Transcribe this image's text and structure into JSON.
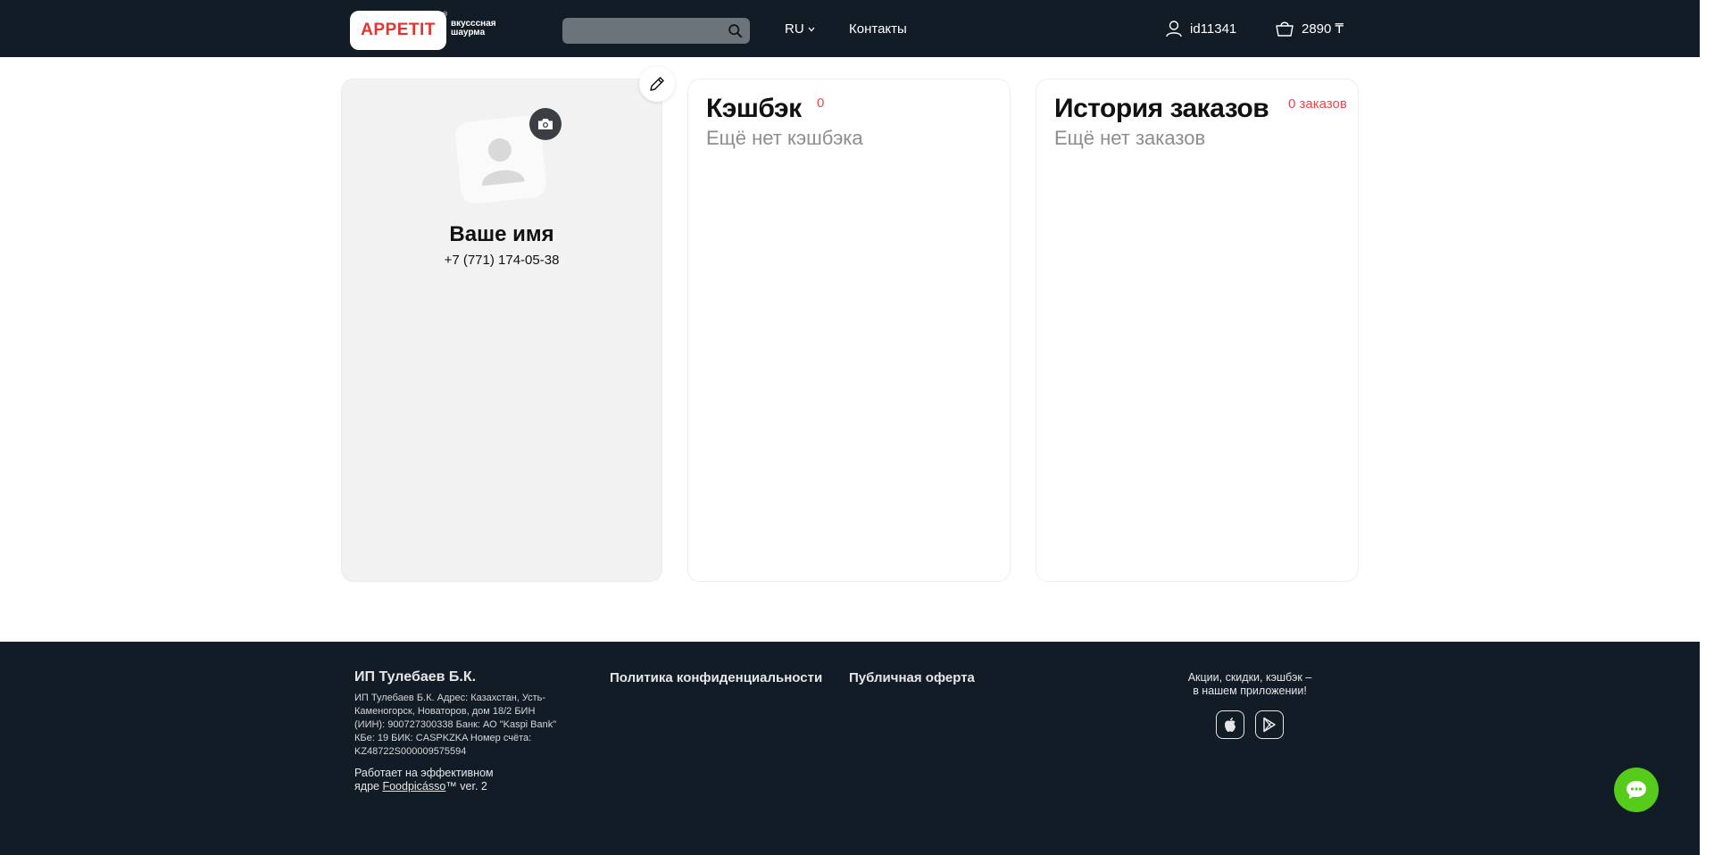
{
  "header": {
    "logo_text": "APPETIT",
    "logo_mark": "®",
    "tagline_line1": "вкусссная",
    "tagline_line2": "шаурма",
    "search": {
      "placeholder": "",
      "value": "",
      "icon": "search-icon"
    },
    "language": "RU",
    "contacts_label": "Контакты",
    "user_id": "id11341",
    "cart_total": "2890 ₸"
  },
  "profile": {
    "name": "Ваше имя",
    "phone": "+7 (771) 174-05-38"
  },
  "cashback": {
    "title": "Кэшбэк",
    "count": "0",
    "empty_text": "Ещё нет кэшбэка"
  },
  "history": {
    "title": "История заказов",
    "count": "0 заказов",
    "empty_text": "Ещё нет заказов"
  },
  "footer": {
    "company": "ИП Тулебаев Б.К.",
    "details": "ИП Тулебаев Б.К. Адрес: Казахстан, Усть-Каменогорск, Новаторов, дом 18/2 БИН (ИИН): 900727300338 Банк: АО \"Kaspi Bank\" КБе: 19 БИК: CASPKZKA Номер счёта: KZ48722S000009575594",
    "powered_prefix": "Работает на эффективном ядре",
    "powered_link": "Foodpicásso",
    "powered_suffix": "™  ver. 2",
    "privacy_label": "Политика конфиденциальности",
    "offer_label": "Публичная оферта",
    "promo_line1": "Акции, скидки, кэшбэк –",
    "promo_line2": "в нашем приложении!"
  },
  "colors": {
    "header_bg": "#111c27",
    "accent_red": "#e5484d",
    "chat_green": "#55cc1a"
  }
}
